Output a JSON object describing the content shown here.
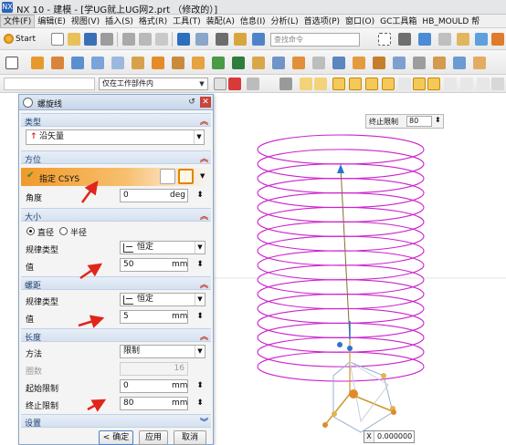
{
  "window": {
    "title": "NX 10 - 建模 - [学UG就上UG网2.prt （修改的）]",
    "app_icon": "NX"
  },
  "menu": {
    "items": [
      {
        "label": "文件(F)",
        "active": true
      },
      {
        "label": "编辑(E)"
      },
      {
        "label": "视图(V)"
      },
      {
        "label": "插入(S)"
      },
      {
        "label": "格式(R)"
      },
      {
        "label": "工具(T)"
      },
      {
        "label": "装配(A)"
      },
      {
        "label": "信息(I)"
      },
      {
        "label": "分析(L)"
      },
      {
        "label": "首选项(P)"
      },
      {
        "label": "窗口(O)"
      },
      {
        "label": "GC工具箱"
      },
      {
        "label": "HB_MOULD 帮"
      }
    ]
  },
  "toolbar": {
    "start_label": "Start",
    "command_search_placeholder": "查找命令",
    "selection_filter": "仅在工作部件内"
  },
  "dialog": {
    "title": "螺旋线",
    "sections": {
      "type": {
        "header": "类型",
        "value": "沿矢量"
      },
      "orientation": {
        "header": "方位",
        "csys_label": "指定 CSYS",
        "angle_label": "角度",
        "angle_value": "0",
        "angle_unit": "deg"
      },
      "size": {
        "header": "大小",
        "radio_diameter": "直径",
        "radio_radius": "半径",
        "selected": "直径",
        "law_type_label": "规律类型",
        "law_type_value": "恒定",
        "value_label": "值",
        "value": "50",
        "unit": "mm"
      },
      "pitch": {
        "header": "螺距",
        "law_type_label": "规律类型",
        "law_type_value": "恒定",
        "value_label": "值",
        "value": "5",
        "unit": "mm"
      },
      "length": {
        "header": "长度",
        "method_label": "方法",
        "method_value": "限制",
        "turns_label": "圈数",
        "turns_value": "16",
        "start_label": "起始限制",
        "start_value": "0",
        "start_unit": "mm",
        "end_label": "终止限制",
        "end_value": "80",
        "end_unit": "mm"
      },
      "settings": {
        "header": "设置"
      }
    },
    "buttons": {
      "ok": "< 确定 >",
      "apply": "应用",
      "cancel": "取消"
    }
  },
  "graphics": {
    "end_limit_label": "终止限制",
    "end_limit_value": "80",
    "coord_label": "X",
    "coord_value": "0.000000",
    "helix_color": "#cc22cc",
    "helix_turns": 16
  },
  "colors": {
    "accent_orange": "#f09a2a",
    "section_text": "#1f3e70",
    "annotation_arrow": "#e0251b"
  }
}
